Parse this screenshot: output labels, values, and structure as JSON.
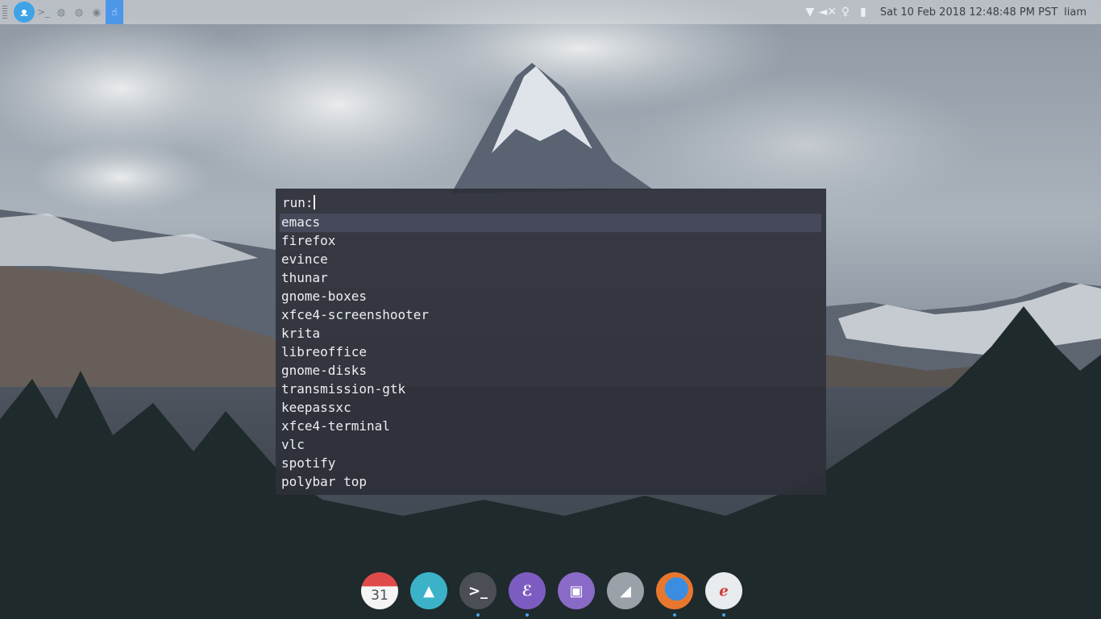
{
  "top_panel": {
    "launchers": [
      {
        "icon": "terminal-icon",
        "label": ">_",
        "active": false
      },
      {
        "icon": "app-icon",
        "label": "",
        "active": false
      },
      {
        "icon": "app-icon",
        "label": "",
        "active": false
      },
      {
        "icon": "globe-icon",
        "label": "",
        "active": false
      },
      {
        "icon": "hand-icon",
        "label": "",
        "active": true
      }
    ],
    "tray_icons": [
      "wifi-icon",
      "volume-muted-icon",
      "bulb-icon",
      "battery-icon"
    ],
    "clock": "Sat 10 Feb 2018 12:48:48 PM PST",
    "username": "liam",
    "accent_color": "#4c97e8"
  },
  "run_dialog": {
    "prompt": "run:",
    "input_value": "",
    "selected_index": 0,
    "entries": [
      "emacs",
      "firefox",
      "evince",
      "thunar",
      "gnome-boxes",
      "xfce4-screenshooter",
      "krita",
      "libreoffice",
      "gnome-disks",
      "transmission-gtk",
      "keepassxc",
      "xfce4-terminal",
      "vlc",
      "spotify",
      "polybar top"
    ]
  },
  "dock": {
    "items": [
      {
        "name": "calendar",
        "icon": "calendar-icon",
        "label": "31",
        "running": false
      },
      {
        "name": "image-viewer",
        "icon": "image-icon",
        "label": "",
        "running": false
      },
      {
        "name": "terminal",
        "icon": "terminal-icon",
        "label": "",
        "running": true
      },
      {
        "name": "emacs",
        "icon": "emacs-icon",
        "label": "",
        "running": true
      },
      {
        "name": "file-manager",
        "icon": "folder-icon",
        "label": "",
        "running": false
      },
      {
        "name": "disks",
        "icon": "drive-icon",
        "label": "",
        "running": false
      },
      {
        "name": "firefox",
        "icon": "firefox-icon",
        "label": "",
        "running": true
      },
      {
        "name": "text-editor",
        "icon": "pen-icon",
        "label": "",
        "running": true
      }
    ]
  }
}
